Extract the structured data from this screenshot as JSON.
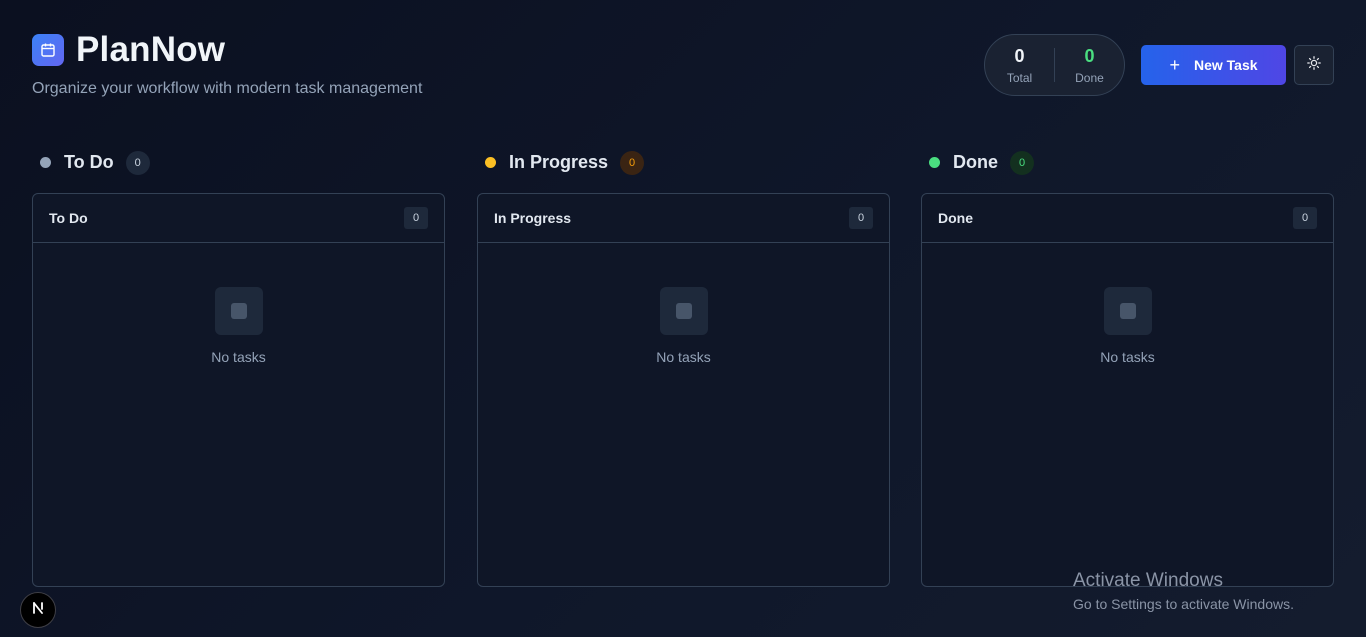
{
  "app": {
    "title": "PlanNow",
    "subtitle": "Organize your workflow with modern task management",
    "logo_icon": "calendar-icon"
  },
  "stats": {
    "total": {
      "value": "0",
      "label": "Total"
    },
    "done": {
      "value": "0",
      "label": "Done"
    }
  },
  "toolbar": {
    "new_task_label": "New Task",
    "new_task_icon": "plus-icon",
    "theme_icon": "sun-icon"
  },
  "colors": {
    "accent": "#3b82f6",
    "todo_dot": "#94a3b8",
    "in_progress_dot": "#fbbf24",
    "done_dot": "#4ade80"
  },
  "columns": [
    {
      "title": "To Do",
      "count": "0",
      "panel_title": "To Do",
      "panel_count": "0",
      "empty_text": "No tasks"
    },
    {
      "title": "In Progress",
      "count": "0",
      "panel_title": "In Progress",
      "panel_count": "0",
      "empty_text": "No tasks"
    },
    {
      "title": "Done",
      "count": "0",
      "panel_title": "Done",
      "panel_count": "0",
      "empty_text": "No tasks"
    }
  ],
  "corner_badge": {
    "letter": "N"
  },
  "watermark": {
    "title": "Activate Windows",
    "subtitle": "Go to Settings to activate Windows."
  }
}
